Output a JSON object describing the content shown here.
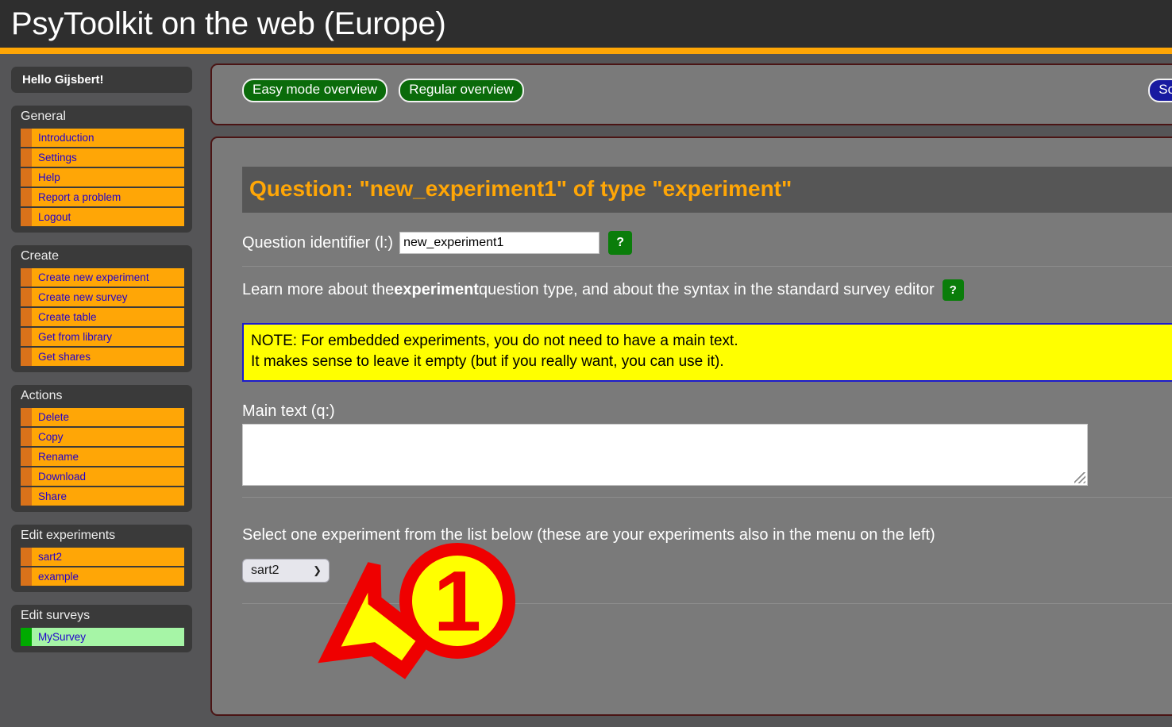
{
  "header": {
    "title": "PsyToolkit on the web (Europe)"
  },
  "sidebar": {
    "greeting": "Hello Gijsbert!",
    "sections": [
      {
        "title": "General",
        "items": [
          {
            "label": "Introduction"
          },
          {
            "label": "Settings"
          },
          {
            "label": "Help"
          },
          {
            "label": "Report a problem"
          },
          {
            "label": "Logout"
          }
        ]
      },
      {
        "title": "Create",
        "items": [
          {
            "label": "Create new experiment"
          },
          {
            "label": "Create new survey"
          },
          {
            "label": "Create table"
          },
          {
            "label": "Get from library"
          },
          {
            "label": "Get shares"
          }
        ]
      },
      {
        "title": "Actions",
        "items": [
          {
            "label": "Delete"
          },
          {
            "label": "Copy"
          },
          {
            "label": "Rename"
          },
          {
            "label": "Download"
          },
          {
            "label": "Share"
          }
        ]
      },
      {
        "title": "Edit experiments",
        "items": [
          {
            "label": "sart2"
          },
          {
            "label": "example"
          }
        ]
      },
      {
        "title": "Edit surveys",
        "items": [
          {
            "label": "MySurvey",
            "highlight": "green"
          }
        ]
      }
    ]
  },
  "toolbar": {
    "easy_mode_label": "Easy mode overview",
    "regular_label": "Regular overview",
    "script_label": "Scrip"
  },
  "content": {
    "question_title": "Question: \"new_experiment1\" of type \"experiment\"",
    "identifier_label": "Question identifier (l:)",
    "identifier_value": "new_experiment1",
    "help_symbol": "?",
    "learn_more_pre": "Learn more about the ",
    "learn_more_bold": "experiment",
    "learn_more_post": " question type, and about the syntax in the standard survey editor",
    "note_line1": "NOTE: For embedded experiments, you do not need to have a main text.",
    "note_line2": "It makes sense to leave it empty (but if you really want, you can use it).",
    "main_text_label": "Main text (q:)",
    "main_text_value": "",
    "select_line": "Select one experiment from the list below (these are your experiments also in the menu on the left)",
    "experiment_selected": "sart2",
    "chevron": "⌄"
  },
  "annotation": {
    "step_number": "1",
    "circle_fill": "#ffff00",
    "circle_stroke": "#ef0000",
    "arrow_fill": "#ffff00",
    "arrow_stroke": "#ef0000"
  },
  "colors": {
    "header_bg": "#2e2e2e",
    "accent_orange": "#ffa606",
    "page_bg": "#555557",
    "panel_bg": "#3a3a3a",
    "menu_item_bg": "#ffa606",
    "menu_link": "#2200cc",
    "card_border": "#4a1414",
    "card_bg": "#7a7a7a",
    "green_button": "#0a6b0a",
    "blue_button": "#181aa0",
    "note_bg": "#ffff00",
    "note_border": "#1a1ad0"
  }
}
